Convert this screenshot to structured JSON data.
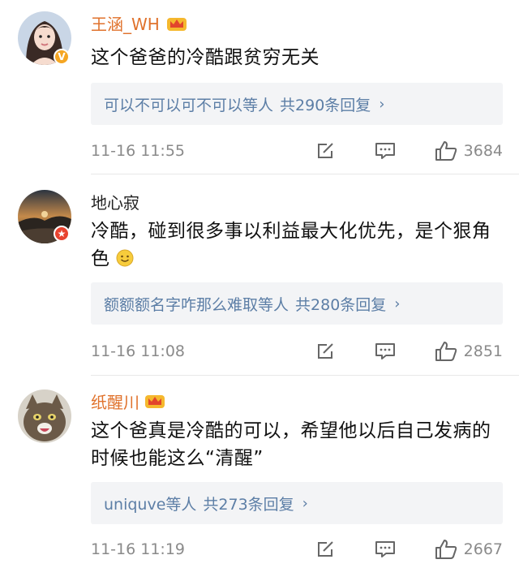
{
  "comments": [
    {
      "username": "王涵_WH",
      "username_color": "#e0722c",
      "text": "这个爸爸的冷酷跟贫穷无关",
      "reply": {
        "users": "可以不可以可不可以等人",
        "summary": "共290条回复"
      },
      "time": "11-16 11:55",
      "likes": "3684",
      "badge": "verified-v-icon"
    },
    {
      "username": "地心寂",
      "username_color": "#222222",
      "text": "冷酷，碰到很多事以利益最大化优先，是个狠角色",
      "reply": {
        "users": "额额额名字咋那么难取等人",
        "summary": "共280条回复"
      },
      "time": "11-16 11:08",
      "likes": "2851",
      "badge": "star-badge-icon"
    },
    {
      "username": "纸醒川",
      "username_color": "#e0722c",
      "text": "这个爸真是冷酷的可以，希望他以后自己发病的时候也能这么“清醒”",
      "reply": {
        "users": "uniquve等人",
        "summary": "共273条回复"
      },
      "time": "11-16 11:19",
      "likes": "2667",
      "badge": ""
    }
  ],
  "colors": {
    "link": "#5c7ea6",
    "meta": "#8a8a8a",
    "vip": "#e0722c",
    "reply_bg": "#f3f4f6"
  }
}
